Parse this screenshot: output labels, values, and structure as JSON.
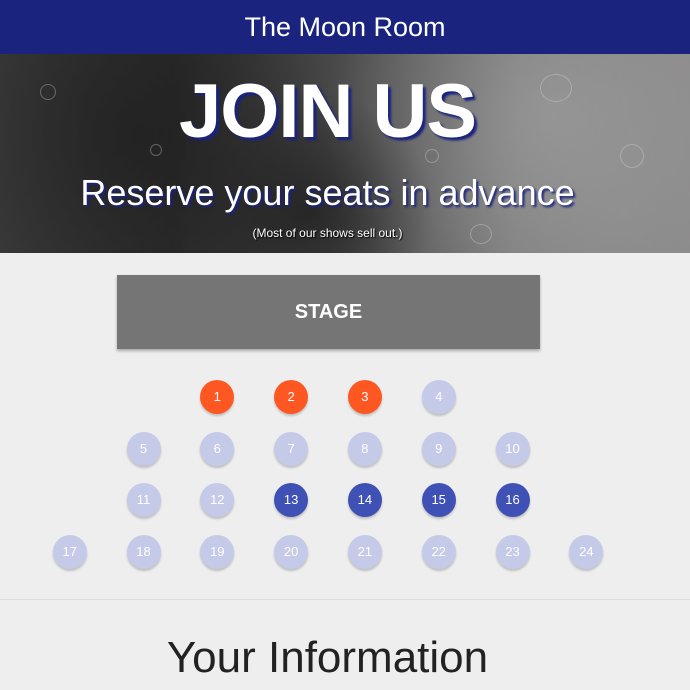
{
  "header": {
    "title": "The Moon Room"
  },
  "hero": {
    "headline": "JOIN US",
    "subheadline": "Reserve your seats in advance",
    "note": "(Most of our shows sell out.)"
  },
  "stage": {
    "label": "STAGE"
  },
  "colors": {
    "reserved": "#ff5722",
    "selected": "#3f51b5",
    "available": "#c5cae9",
    "header": "#1a237e",
    "stage": "#757575"
  },
  "seat_rows": [
    [
      {
        "n": "1",
        "status": "reserved"
      },
      {
        "n": "2",
        "status": "reserved"
      },
      {
        "n": "3",
        "status": "reserved"
      },
      {
        "n": "4",
        "status": "available"
      }
    ],
    [
      {
        "n": "5",
        "status": "available"
      },
      {
        "n": "6",
        "status": "available"
      },
      {
        "n": "7",
        "status": "available"
      },
      {
        "n": "8",
        "status": "available"
      },
      {
        "n": "9",
        "status": "available"
      },
      {
        "n": "10",
        "status": "available"
      }
    ],
    [
      {
        "n": "11",
        "status": "available"
      },
      {
        "n": "12",
        "status": "available"
      },
      {
        "n": "13",
        "status": "selected"
      },
      {
        "n": "14",
        "status": "selected"
      },
      {
        "n": "15",
        "status": "selected"
      },
      {
        "n": "16",
        "status": "selected"
      }
    ],
    [
      {
        "n": "17",
        "status": "available"
      },
      {
        "n": "18",
        "status": "available"
      },
      {
        "n": "19",
        "status": "available"
      },
      {
        "n": "20",
        "status": "available"
      },
      {
        "n": "21",
        "status": "available"
      },
      {
        "n": "22",
        "status": "available"
      },
      {
        "n": "23",
        "status": "available"
      },
      {
        "n": "24",
        "status": "available"
      }
    ]
  ],
  "section": {
    "title": "Your Information"
  }
}
